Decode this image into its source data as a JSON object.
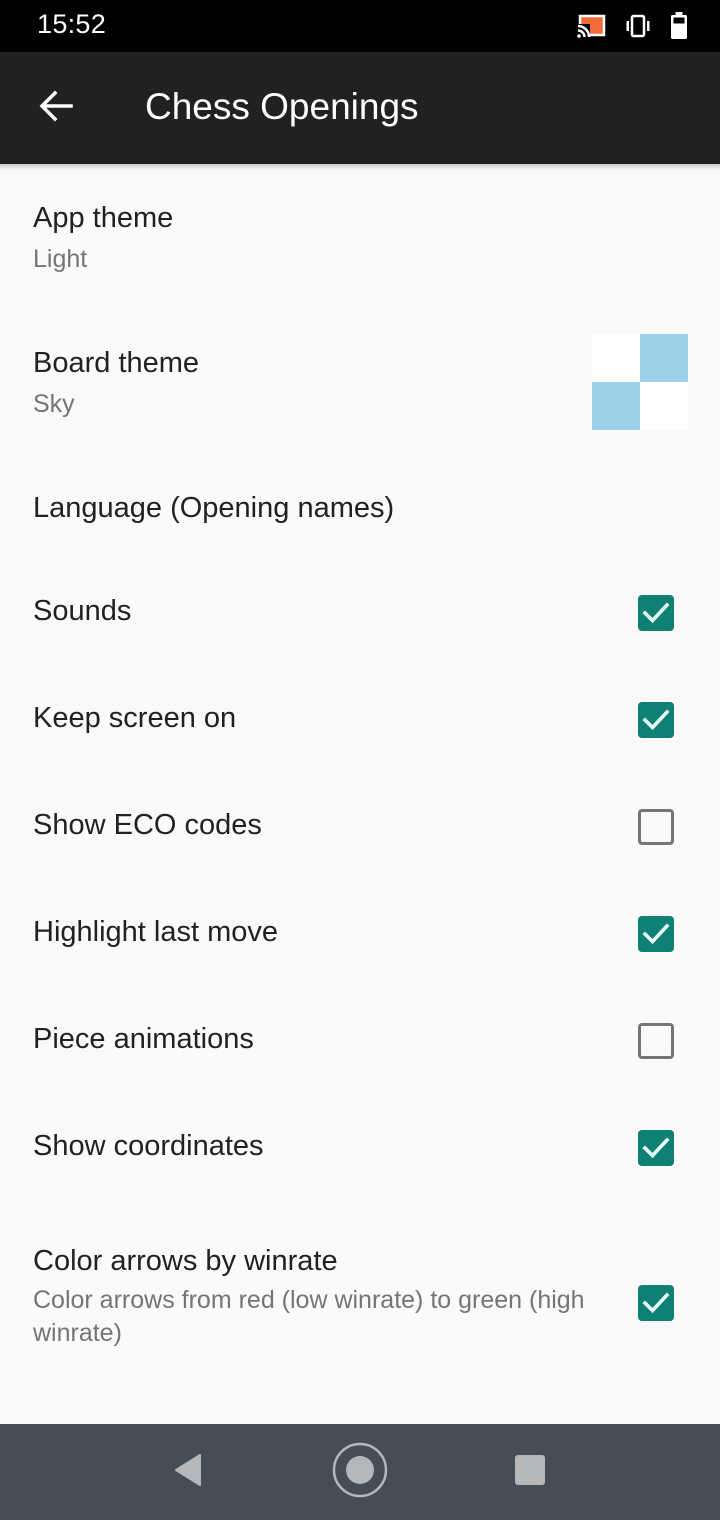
{
  "status_bar": {
    "time": "15:52",
    "icons": [
      "cast-icon",
      "vibrate-icon",
      "battery-icon"
    ],
    "cast_color": "#f26b3a"
  },
  "app_bar": {
    "title": "Chess Openings",
    "back_icon": "arrow-left-icon"
  },
  "settings": {
    "app_theme": {
      "title": "App theme",
      "summary": "Light"
    },
    "board_theme": {
      "title": "Board theme",
      "summary": "Sky",
      "preview_colors": {
        "light": "#ffffff",
        "dark": "#9fcfe9"
      }
    },
    "language": {
      "title": "Language (Opening names)"
    },
    "toggles": [
      {
        "id": "sounds",
        "title": "Sounds",
        "checked": true
      },
      {
        "id": "keep_screen_on",
        "title": "Keep screen on",
        "checked": true
      },
      {
        "id": "show_eco_codes",
        "title": "Show ECO codes",
        "checked": false
      },
      {
        "id": "highlight_last_move",
        "title": "Highlight last move",
        "checked": true
      },
      {
        "id": "piece_animations",
        "title": "Piece animations",
        "checked": false
      },
      {
        "id": "show_coordinates",
        "title": "Show coordinates",
        "checked": true
      }
    ],
    "color_arrows": {
      "title": "Color arrows by winrate",
      "summary": "Color arrows from red (low winrate) to green (high winrate)",
      "checked": true
    },
    "accent_color": "#0f8074"
  },
  "nav_bar": {
    "buttons": [
      "back-triangle-icon",
      "home-circle-icon",
      "recents-square-icon"
    ]
  }
}
